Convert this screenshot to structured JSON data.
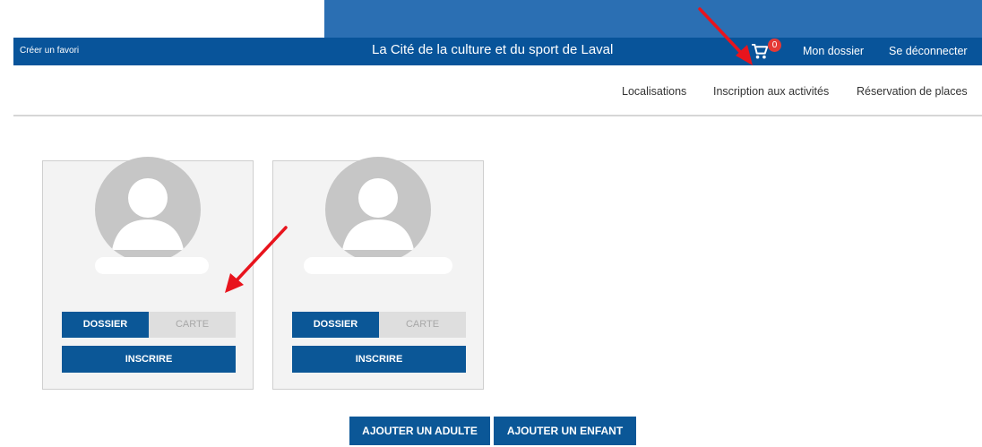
{
  "header": {
    "favorite_link": "Créer un favori",
    "site_title": "La Cité de la culture et du sport de Laval",
    "cart": {
      "icon": "shopping-cart-icon",
      "count": "0"
    },
    "my_file_link": "Mon dossier",
    "logout_link": "Se déconnecter"
  },
  "nav": {
    "items": [
      {
        "label": "Localisations"
      },
      {
        "label": "Inscription aux activités"
      },
      {
        "label": "Réservation de places"
      }
    ]
  },
  "members": [
    {
      "avatar_icon": "user-avatar-icon",
      "dossier_label": "DOSSIER",
      "carte_label": "CARTE",
      "inscrire_label": "INSCRIRE"
    },
    {
      "avatar_icon": "user-avatar-icon",
      "dossier_label": "DOSSIER",
      "carte_label": "CARTE",
      "inscrire_label": "INSCRIRE"
    }
  ],
  "actions": {
    "add_adult_label": "AJOUTER UN ADULTE",
    "add_child_label": "AJOUTER UN ENFANT"
  },
  "colors": {
    "header_blue": "#08549a",
    "button_blue": "#0b5797",
    "badge_red": "#e53935",
    "annotation_red": "#e8141d"
  }
}
